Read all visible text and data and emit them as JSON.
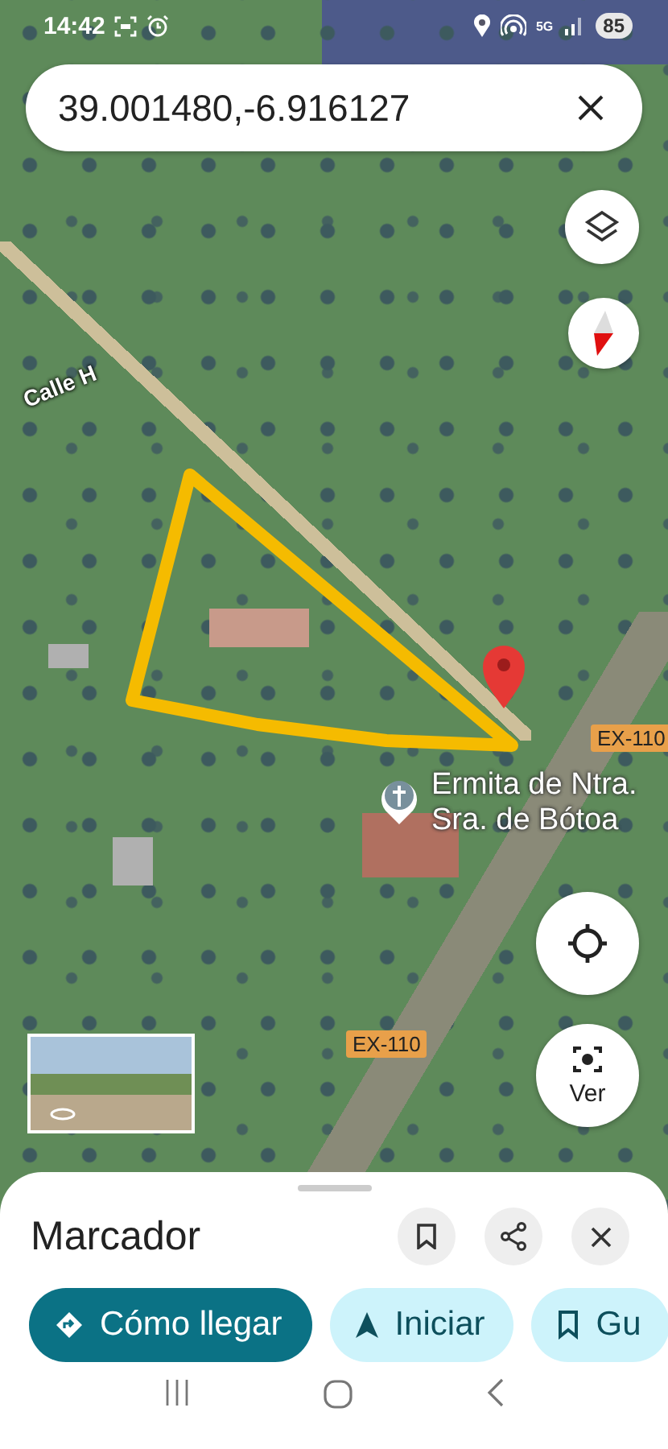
{
  "status_bar": {
    "time": "14:42",
    "network": "5G",
    "battery": "85"
  },
  "search": {
    "value": "39.001480,-6.916127"
  },
  "map": {
    "labels": [
      {
        "kind": "street",
        "text": "Calle H"
      },
      {
        "kind": "place",
        "text": "Ermita de Ntra. Sra. de Bótoa"
      },
      {
        "kind": "road",
        "text": "EX-110"
      },
      {
        "kind": "road",
        "text": "EX-110"
      }
    ]
  },
  "map_buttons": {
    "lens_label": "Ver"
  },
  "sheet": {
    "title": "Marcador",
    "actions": [
      {
        "label": "Cómo llegar",
        "kind": "primary"
      },
      {
        "label": "Iniciar",
        "kind": "start"
      },
      {
        "label": "Gu",
        "kind": "save"
      }
    ]
  }
}
